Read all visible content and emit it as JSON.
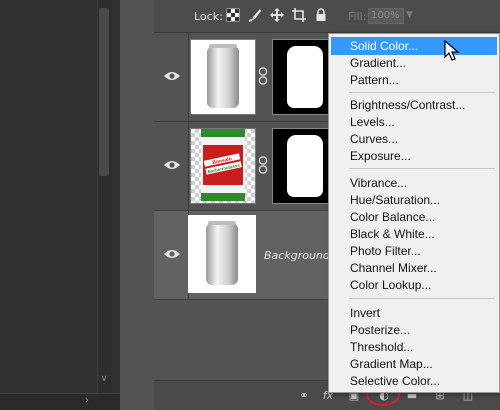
{
  "layers_panel": {
    "lock_label": "Lock:",
    "fill_label": "Fill:",
    "fill_value": "100%",
    "layers": [
      {
        "name": "",
        "visible": true,
        "has_mask": true
      },
      {
        "name": "",
        "visible": true,
        "has_mask": true,
        "smart_object": true
      },
      {
        "name": "Background",
        "visible": true,
        "has_mask": false,
        "selected": true
      }
    ]
  },
  "adjustment_menu": {
    "groups": [
      [
        "Solid Color...",
        "Gradient...",
        "Pattern..."
      ],
      [
        "Brightness/Contrast...",
        "Levels...",
        "Curves...",
        "Exposure..."
      ],
      [
        "Vibrance...",
        "Hue/Saturation...",
        "Color Balance...",
        "Black & White...",
        "Photo Filter...",
        "Channel Mixer...",
        "Color Lookup..."
      ],
      [
        "Invert",
        "Posterize...",
        "Threshold...",
        "Gradient Map...",
        "Selective Color..."
      ]
    ],
    "highlighted": "Solid Color..."
  },
  "label_art": {
    "line1": "Bonsalo",
    "line2": "Barbermutasss"
  },
  "colors": {
    "highlight": "#3399ff",
    "panel": "#535353",
    "annotation": "#d81e2a"
  }
}
